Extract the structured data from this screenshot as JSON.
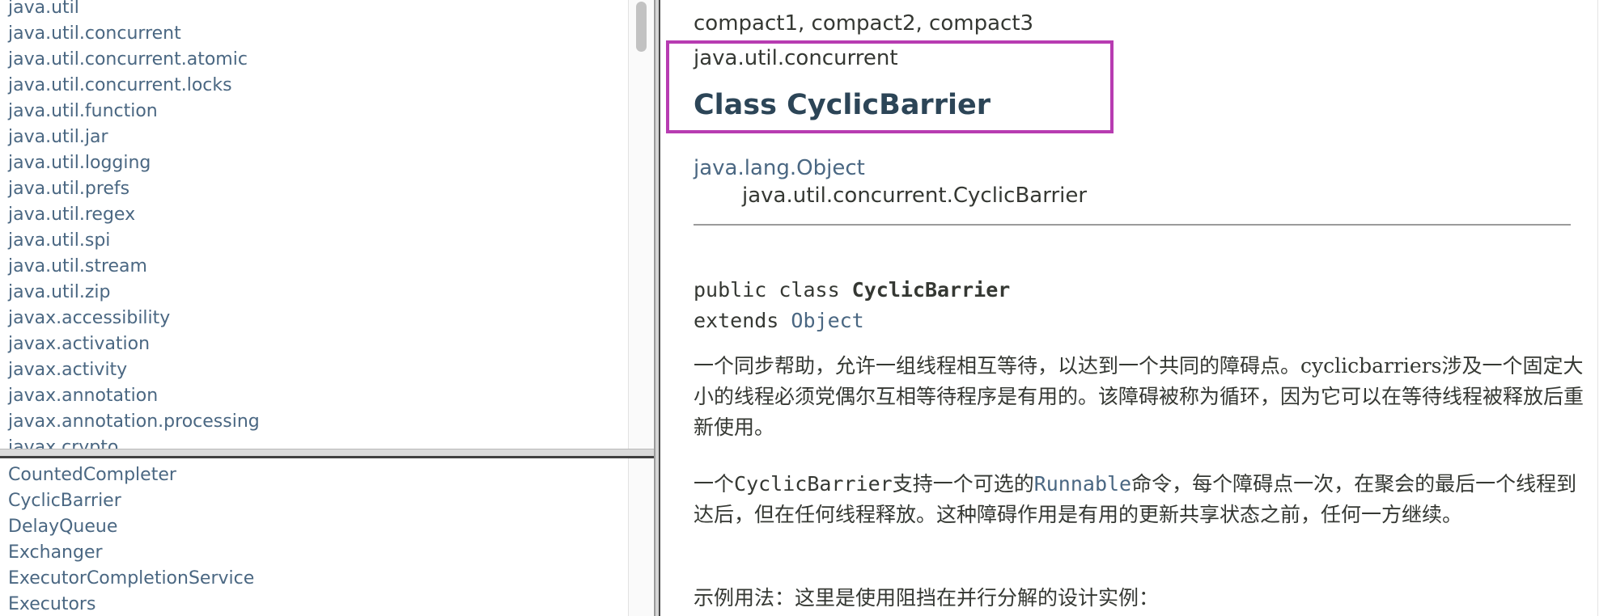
{
  "package_list": [
    "java.util",
    "java.util.concurrent",
    "java.util.concurrent.atomic",
    "java.util.concurrent.locks",
    "java.util.function",
    "java.util.jar",
    "java.util.logging",
    "java.util.prefs",
    "java.util.regex",
    "java.util.spi",
    "java.util.stream",
    "java.util.zip",
    "javax.accessibility",
    "javax.activation",
    "javax.activity",
    "javax.annotation",
    "javax.annotation.processing",
    "javax.crypto"
  ],
  "class_list": [
    "CountedCompleter",
    "CyclicBarrier",
    "DelayQueue",
    "Exchanger",
    "ExecutorCompletionService",
    "Executors"
  ],
  "main": {
    "profiles": "compact1, compact2, compact3",
    "package_label": "java.util.concurrent",
    "class_title": "Class CyclicBarrier",
    "inheritance": {
      "parent": "java.lang.Object",
      "child": "java.util.concurrent.CyclicBarrier"
    },
    "signature": {
      "prefix": "public class ",
      "class_name": "CyclicBarrier",
      "extends_kw": "extends ",
      "extends_link": "Object"
    },
    "para1": "一个同步帮助，允许一组线程相互等待，以达到一个共同的障碍点。cyclicbarriers涉及一个固定大小的线程必须党偶尔互相等待程序是有用的。该障碍被称为循环，因为它可以在等待线程被释放后重新使用。",
    "para2": {
      "t1": "一个",
      "code1": "CyclicBarrier",
      "t2": "支持一个可选的",
      "code2": "Runnable",
      "t3": "命令，每个障碍点一次，在聚会的最后一个线程到达后，但在任何线程释放。这种障碍作用是有用的更新共享状态之前，任何一方继续。"
    },
    "para3": "示例用法：这里是使用阻挡在并行分解的设计实例："
  },
  "colors": {
    "link": "#4a6782",
    "text": "#353833",
    "title": "#2c4557",
    "highlight": "#b73cb1"
  }
}
